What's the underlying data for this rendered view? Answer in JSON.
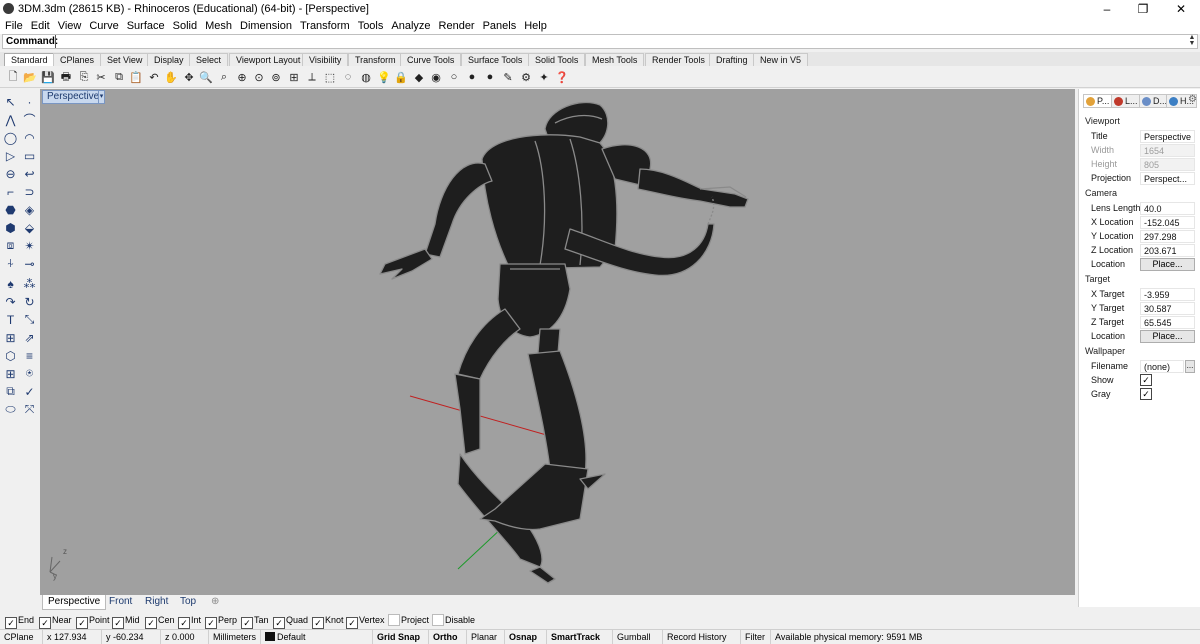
{
  "window": {
    "title": "3DM.3dm (28615 KB) - Rhinoceros (Educational) (64-bit) - [Perspective]",
    "controls": [
      "–",
      "❐",
      "✕"
    ]
  },
  "menu": [
    "File",
    "Edit",
    "View",
    "Curve",
    "Surface",
    "Solid",
    "Mesh",
    "Dimension",
    "Transform",
    "Tools",
    "Analyze",
    "Render",
    "Panels",
    "Help"
  ],
  "command": {
    "label": "Command:",
    "value": ""
  },
  "tabs": [
    "Standard",
    "CPlanes",
    "Set View",
    "Display",
    "Select",
    "Viewport Layout",
    "Visibility",
    "Transform",
    "Curve Tools",
    "Surface Tools",
    "Solid Tools",
    "Mesh Tools",
    "Render Tools",
    "Drafting",
    "New in V5"
  ],
  "toolbar_icons": [
    "new-file-icon",
    "open-file-icon",
    "save-icon",
    "print-icon",
    "import-icon",
    "cut-icon",
    "copy-icon",
    "paste-icon",
    "undo-icon",
    "pan-icon",
    "rotate-view-icon",
    "zoom-icon",
    "zoom-window-icon",
    "zoom-extents-icon",
    "zoom-selected-icon",
    "zoom-all-icon",
    "4-viewports-icon",
    "set-cplane-icon",
    "select-icon",
    "hide-icon",
    "show-icon",
    "lock-icon",
    "unlock-icon",
    "layer-icon",
    "properties-icon",
    "wireframe-icon",
    "shaded-icon",
    "rendered-icon",
    "render-icon",
    "options-icon",
    "help-icon"
  ],
  "viewport": {
    "name": "Perspective"
  },
  "viewport_tabs": [
    "Perspective",
    "Front",
    "Right",
    "Top",
    "⊕"
  ],
  "panel": {
    "tabs": [
      "P...",
      "L...",
      "D...",
      "H..."
    ],
    "viewport_header": "Viewport",
    "title_label": "Title",
    "title_value": "Perspective",
    "width_label": "Width",
    "width_value": "1654",
    "height_label": "Height",
    "height_value": "805",
    "projection_label": "Projection",
    "projection_value": "Perspect...",
    "camera_header": "Camera",
    "lens_label": "Lens Length",
    "lens_value": "40.0",
    "xloc_label": "X Location",
    "xloc_value": "-152.045",
    "yloc_label": "Y Location",
    "yloc_value": "297.298",
    "zloc_label": "Z Location",
    "zloc_value": "203.671",
    "cam_location_label": "Location",
    "cam_place": "Place...",
    "target_header": "Target",
    "xt_label": "X Target",
    "xt_value": "-3.959",
    "yt_label": "Y Target",
    "yt_value": "30.587",
    "zt_label": "Z Target",
    "zt_value": "65.545",
    "tgt_location_label": "Location",
    "tgt_place": "Place...",
    "wallpaper_header": "Wallpaper",
    "filename_label": "Filename",
    "filename_value": "(none)",
    "filename_btn": "...",
    "show_label": "Show",
    "gray_label": "Gray"
  },
  "osnaps": [
    {
      "label": "End",
      "checked": true
    },
    {
      "label": "Near",
      "checked": true
    },
    {
      "label": "Point",
      "checked": true
    },
    {
      "label": "Mid",
      "checked": true
    },
    {
      "label": "Cen",
      "checked": true
    },
    {
      "label": "Int",
      "checked": true
    },
    {
      "label": "Perp",
      "checked": true
    },
    {
      "label": "Tan",
      "checked": true
    },
    {
      "label": "Quad",
      "checked": true
    },
    {
      "label": "Knot",
      "checked": true
    },
    {
      "label": "Vertex",
      "checked": true
    },
    {
      "label": "Project",
      "checked": false
    },
    {
      "label": "Disable",
      "checked": false
    }
  ],
  "status": {
    "cplane": "CPlane",
    "x": "x 127.934",
    "y": "y -60.234",
    "z": "z 0.000",
    "units": "Millimeters",
    "layer": "Default",
    "grid_snap": "Grid Snap",
    "ortho": "Ortho",
    "planar": "Planar",
    "osnap": "Osnap",
    "smarttrack": "SmartTrack",
    "gumball": "Gumball",
    "record_history": "Record History",
    "filter": "Filter",
    "memory": "Available physical memory: 9591 MB"
  },
  "axis_labels": {
    "z": "z",
    "y": "y"
  }
}
